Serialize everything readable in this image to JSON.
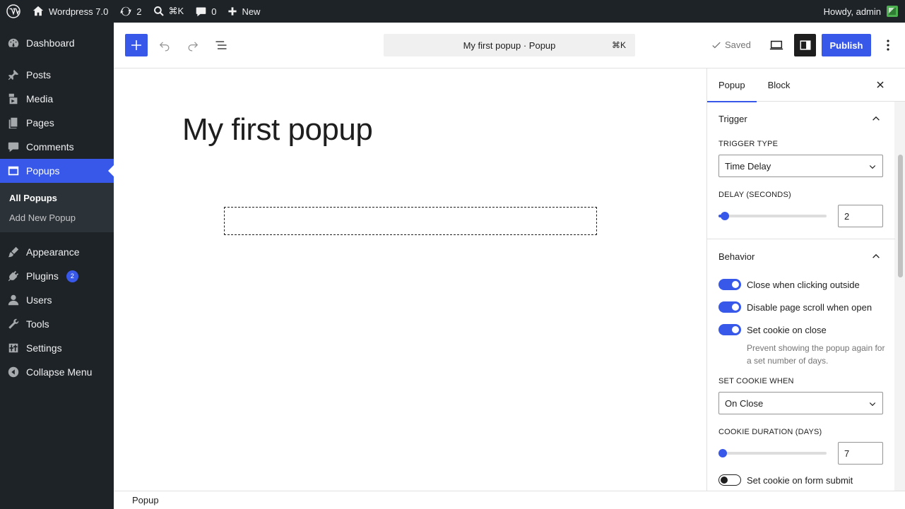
{
  "adminbar": {
    "site_name": "Wordpress 7.0",
    "updates_count": "2",
    "search_shortcut": "⌘K",
    "comments_count": "0",
    "new_label": "New",
    "howdy": "Howdy, admin"
  },
  "sidebar": {
    "items": [
      {
        "label": "Dashboard"
      },
      {
        "label": "Posts"
      },
      {
        "label": "Media"
      },
      {
        "label": "Pages"
      },
      {
        "label": "Comments"
      },
      {
        "label": "Popups"
      },
      {
        "label": "Appearance"
      },
      {
        "label": "Plugins",
        "badge": "2"
      },
      {
        "label": "Users"
      },
      {
        "label": "Tools"
      },
      {
        "label": "Settings"
      },
      {
        "label": "Collapse Menu"
      }
    ],
    "submenu": [
      "All Popups",
      "Add New Popup"
    ]
  },
  "header": {
    "command_title": "My first popup · Popup",
    "command_shortcut": "⌘K",
    "saved_label": "Saved",
    "publish_label": "Publish"
  },
  "canvas": {
    "title": "My first popup"
  },
  "settings": {
    "tabs": [
      "Popup",
      "Block"
    ],
    "trigger": {
      "heading": "Trigger",
      "type_label": "TRIGGER TYPE",
      "type_value": "Time Delay",
      "delay_label": "DELAY (SECONDS)",
      "delay_value": "2",
      "delay_fraction": 0.02
    },
    "behavior": {
      "heading": "Behavior",
      "toggles": [
        {
          "label": "Close when clicking outside",
          "on": true
        },
        {
          "label": "Disable page scroll when open",
          "on": true
        },
        {
          "label": "Set cookie on close",
          "on": true
        }
      ],
      "help": "Prevent showing the popup again for a set number of days.",
      "cookie_when_label": "SET COOKIE WHEN",
      "cookie_when_value": "On Close",
      "duration_label": "COOKIE DURATION (DAYS)",
      "duration_value": "7",
      "duration_fraction": 0.0,
      "form_toggle": {
        "label": "Set cookie on form submit",
        "on": false
      }
    }
  },
  "footer": {
    "breadcrumb": "Popup"
  },
  "colors": {
    "accent": "#3858e9",
    "admin_bg": "#1d2327"
  }
}
